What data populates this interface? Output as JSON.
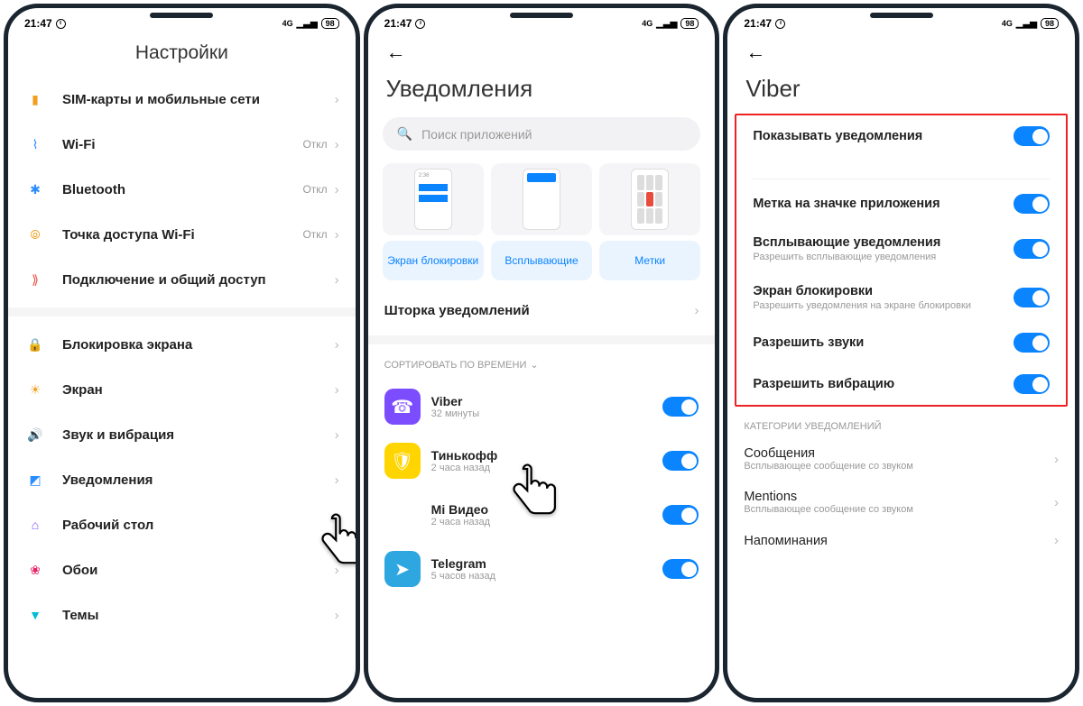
{
  "status": {
    "time": "21:47",
    "battery": "98",
    "net": "4G"
  },
  "p1": {
    "title": "Настройки",
    "items": [
      {
        "label": "SIM-карты и мобильные сети",
        "status": "",
        "color": "#f0a020",
        "ico": "▮"
      },
      {
        "label": "Wi-Fi",
        "status": "Откл",
        "color": "#2b8cff",
        "ico": "⌇"
      },
      {
        "label": "Bluetooth",
        "status": "Откл",
        "color": "#2b8cff",
        "ico": "✱"
      },
      {
        "label": "Точка доступа Wi-Fi",
        "status": "Откл",
        "color": "#f0a020",
        "ico": "⦾"
      },
      {
        "label": "Подключение и общий доступ",
        "status": "",
        "color": "#e74c3c",
        "ico": "⟫"
      }
    ],
    "items2": [
      {
        "label": "Блокировка экрана",
        "color": "#e74c3c",
        "ico": "🔒"
      },
      {
        "label": "Экран",
        "color": "#f0a020",
        "ico": "☀"
      },
      {
        "label": "Звук и вибрация",
        "color": "#1abc5c",
        "ico": "🔊"
      },
      {
        "label": "Уведомления",
        "color": "#2b8cff",
        "ico": "◩"
      },
      {
        "label": "Рабочий стол",
        "color": "#7c4dff",
        "ico": "⌂"
      },
      {
        "label": "Обои",
        "color": "#e91e63",
        "ico": "❀"
      },
      {
        "label": "Темы",
        "color": "#00bcd4",
        "ico": "▼"
      }
    ]
  },
  "p2": {
    "title": "Уведомления",
    "search_ph": "Поиск приложений",
    "types": [
      {
        "label": "Экран блокировки"
      },
      {
        "label": "Всплывающие"
      },
      {
        "label": "Метки"
      }
    ],
    "shade": "Шторка уведомлений",
    "sort": "СОРТИРОВАТЬ ПО ВРЕМЕНИ",
    "apps": [
      {
        "name": "Viber",
        "sub": "32 минуты",
        "bg": "#7c4dff",
        "ico": "☎"
      },
      {
        "name": "Тинькофф",
        "sub": "2 часа назад",
        "bg": "#ffd500",
        "ico": "🛡"
      },
      {
        "name": "Mi Видео",
        "sub": "2 часа назад",
        "bg": "#fff",
        "ico": "▶"
      },
      {
        "name": "Telegram",
        "sub": "5 часов назад",
        "bg": "#2ea6e0",
        "ico": "➤"
      }
    ]
  },
  "p3": {
    "title": "Viber",
    "toggles": [
      {
        "label": "Показывать уведомления",
        "sub": ""
      },
      {
        "label": "Метка на значке приложения",
        "sub": ""
      },
      {
        "label": "Всплывающие уведомления",
        "sub": "Разрешить всплывающие уведомления"
      },
      {
        "label": "Экран блокировки",
        "sub": "Разрешить уведомления на экране блокировки"
      },
      {
        "label": "Разрешить звуки",
        "sub": ""
      },
      {
        "label": "Разрешить вибрацию",
        "sub": ""
      }
    ],
    "cat_header": "КАТЕГОРИИ УВЕДОМЛЕНИЙ",
    "cats": [
      {
        "label": "Сообщения",
        "sub": "Всплывающее сообщение со звуком"
      },
      {
        "label": "Mentions",
        "sub": "Всплывающее сообщение со звуком"
      },
      {
        "label": "Напоминания",
        "sub": ""
      }
    ]
  }
}
